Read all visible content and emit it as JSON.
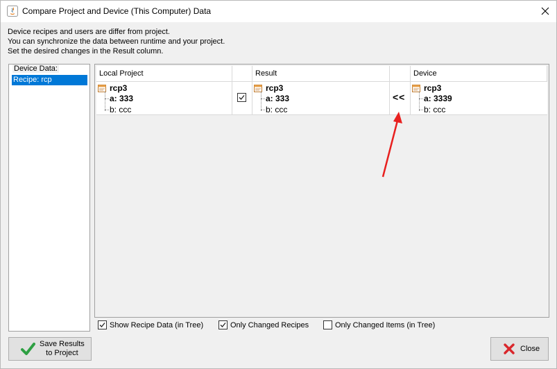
{
  "window": {
    "title": "Compare Project and Device (This Computer) Data",
    "close_glyph": "✕"
  },
  "intro": {
    "line1": "Device recipes and users are differ from project.",
    "line2": "You can synchronize the data between runtime and your project.",
    "line3": "Set the desired changes in the Result column."
  },
  "device_panel": {
    "legend": "Device Data:",
    "items": [
      {
        "label": "Recipe: rcp",
        "selected": true
      }
    ]
  },
  "table": {
    "headers": {
      "local": "Local Project",
      "check": "",
      "result": "Result",
      "action": "",
      "device": "Device"
    },
    "rows": [
      {
        "local": {
          "name": "rcp3",
          "a": "a: 333",
          "b": "b: ccc"
        },
        "checked": true,
        "check_glyph": "✓",
        "result": {
          "name": "rcp3",
          "a": "a: 333",
          "b": "b: ccc"
        },
        "action": "<<",
        "device": {
          "name": "rcp3",
          "a": "a: 3339",
          "b": "b: ccc"
        }
      }
    ]
  },
  "options": {
    "show_tree": {
      "label": "Show Recipe Data (in Tree)",
      "checked": true
    },
    "only_recipes": {
      "label": "Only Changed Recipes",
      "checked": true
    },
    "only_items": {
      "label": "Only Changed Items (in Tree)",
      "checked": false
    },
    "check_glyph": "✓"
  },
  "buttons": {
    "save_line1": "Save Results",
    "save_line2": "to Project",
    "close": "Close"
  },
  "colors": {
    "selection": "#0078d7",
    "annotation_arrow": "#e8201f",
    "save_check": "#2ea043",
    "close_x": "#d9262b"
  }
}
